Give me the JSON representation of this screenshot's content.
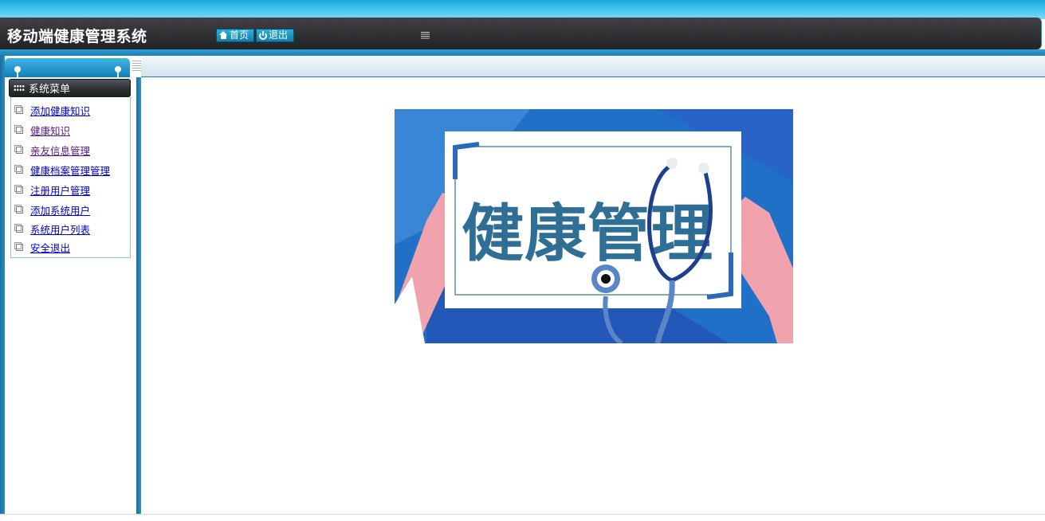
{
  "header": {
    "title": "移动端健康管理系统",
    "home_label": "首页",
    "logout_label": "退出"
  },
  "sidebar": {
    "menu_title": "系统菜单",
    "items": [
      {
        "label": "添加健康知识",
        "visited": false
      },
      {
        "label": "健康知识",
        "visited": true
      },
      {
        "label": "亲友信息管理",
        "visited": true
      },
      {
        "label": "健康档案管理管理",
        "visited": false
      },
      {
        "label": "注册用户管理",
        "visited": false
      },
      {
        "label": "添加系统用户",
        "visited": false
      },
      {
        "label": "系统用户列表",
        "visited": false
      },
      {
        "label": "安全退出",
        "visited": false
      }
    ]
  },
  "main": {
    "banner_text": "健康管理"
  },
  "icons": {
    "home": "home-icon",
    "logout": "power-icon",
    "collapse": "menu-collapse-icon",
    "menu": "grid-icon",
    "item": "document-icon"
  },
  "colors": {
    "header_dark": "#2c2e31",
    "accent_blue": "#1c8fc7",
    "link": "#0000cc",
    "link_visited": "#551a8b",
    "banner_blue": "#1e6cc4",
    "banner_text": "#2f6f95"
  }
}
